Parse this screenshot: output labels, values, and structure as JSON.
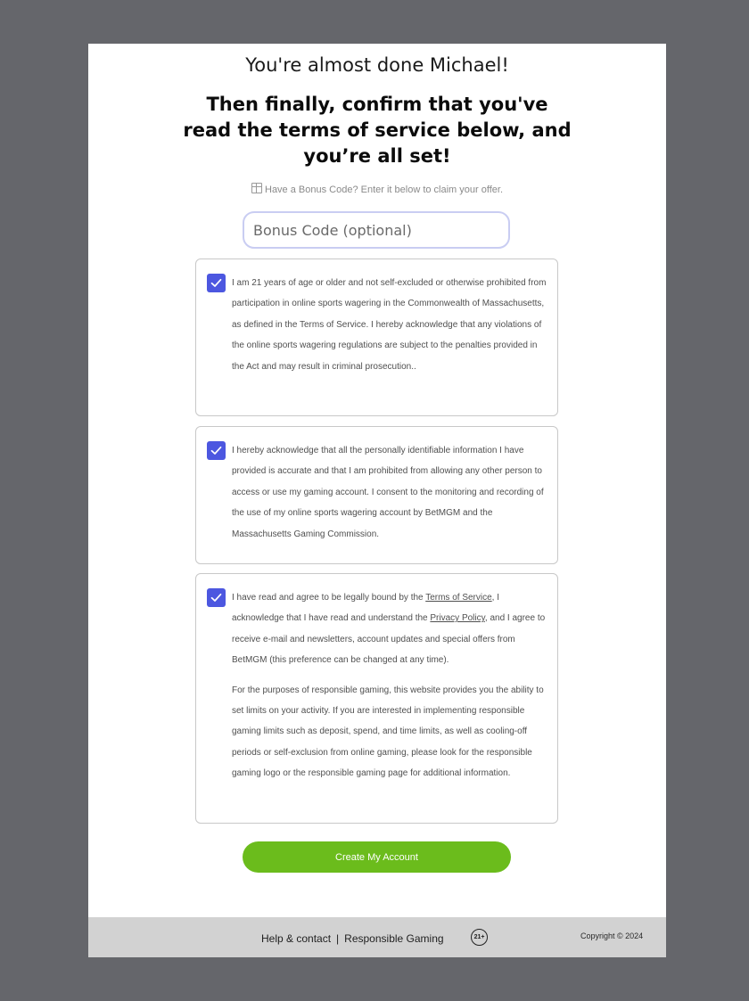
{
  "header": {
    "greeting": "You're almost done Michael!",
    "headline": "Then finally, confirm that you've read the terms of service below, and you’re all set!"
  },
  "bonus": {
    "hint": "Have a Bonus Code? Enter it below to claim your offer.",
    "placeholder": "Bonus Code (optional)",
    "value": ""
  },
  "consents": {
    "age": {
      "checked": true,
      "text": "I am 21 years of age or older and not self-excluded or otherwise prohibited from participation in online sports wagering in the Commonwealth of Massachusetts, as defined in the Terms of Service. I hereby acknowledge that any violations of the online sports wagering regulations are subject to the penalties provided in the Act and may result in criminal prosecution.."
    },
    "accuracy": {
      "checked": true,
      "text": "I hereby acknowledge that all the personally identifiable information I have provided is accurate and that I am prohibited from allowing any other person to access or use my gaming account. I consent to the monitoring and recording of the use of my online sports wagering account by BetMGM and the Massachusetts Gaming Commission."
    },
    "terms": {
      "checked": true,
      "text_part1": "I have read and agree to be legally bound by the ",
      "terms_link": "Terms of Service",
      "text_part2": ", I acknowledge that I have read and understand the ",
      "privacy_link": "Privacy Policy",
      "text_part3": ", and I agree to receive e-mail and newsletters, account updates and special offers from BetMGM (this preference can be changed at any time).",
      "responsible_text": "For the purposes of responsible gaming, this website provides you the ability to set limits on your activity. If you are interested in implementing responsible gaming limits such as deposit, spend, and time limits, as well as cooling-off periods or self-exclusion from online gaming, please look for the responsible gaming logo or the responsible gaming page for additional information."
    }
  },
  "submit_label": "Create My Account",
  "footer": {
    "help_label": "Help & contact",
    "separator": "|",
    "responsible_label": "Responsible Gaming",
    "age_badge": "21+",
    "copyright": "Copyright © 2024"
  },
  "colors": {
    "accent": "#4c57e0",
    "button": "#6bbc1c",
    "background": "#65666b",
    "footer": "#d2d2d2"
  },
  "icons": {
    "bonus_hint": "gift-icon",
    "checkbox": "checkmark-icon"
  }
}
